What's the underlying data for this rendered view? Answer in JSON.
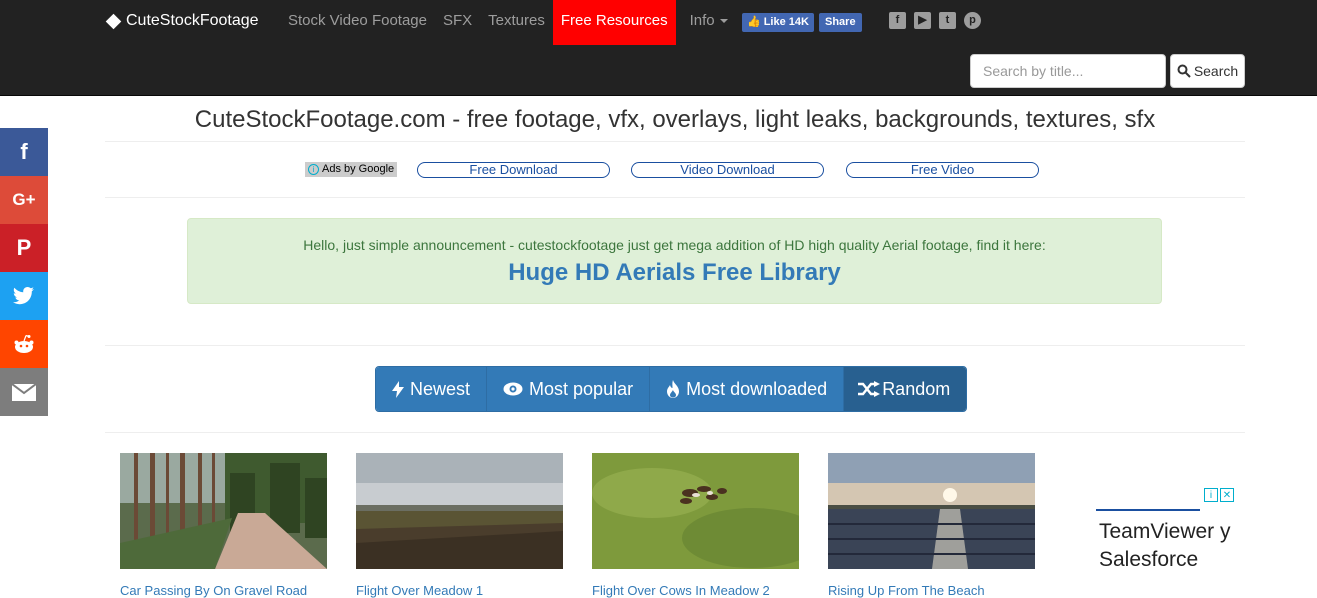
{
  "navbar": {
    "brand": "CuteStockFootage",
    "links": [
      {
        "label": "Stock Video Footage"
      },
      {
        "label": "SFX"
      },
      {
        "label": "Textures"
      },
      {
        "label": "Free Resources"
      },
      {
        "label": "Info"
      }
    ],
    "fb_like": "Like 14K",
    "fb_share": "Share",
    "social_icons": [
      "facebook-icon",
      "youtube-icon",
      "twitter-icon",
      "pinterest-icon"
    ],
    "search": {
      "placeholder": "Search by title...",
      "button": "Search"
    }
  },
  "share_bar": [
    {
      "icon": "facebook-icon",
      "glyph": "f",
      "color": "#3b5998"
    },
    {
      "icon": "google-plus-icon",
      "glyph": "G+",
      "color": "#dd4b39"
    },
    {
      "icon": "pinterest-icon",
      "glyph": "P",
      "color": "#cb2027"
    },
    {
      "icon": "twitter-icon",
      "glyph": "t",
      "color": "#1da1f2"
    },
    {
      "icon": "reddit-icon",
      "glyph": "r",
      "color": "#ff4500"
    },
    {
      "icon": "email-icon",
      "glyph": "✉",
      "color": "#7d7d7d"
    }
  ],
  "headline": "CuteStockFootage.com - free footage, vfx, overlays, light leaks, backgrounds, textures, sfx",
  "ads": {
    "label": "Ads by Google",
    "links": [
      "Free Download",
      "Video Download",
      "Free Video"
    ]
  },
  "announcement": {
    "text": "Hello, just simple announcement - cutestockfootage just get mega addition of HD high quality Aerial footage, find it here:",
    "link": "Huge HD Aerials Free Library"
  },
  "sort_buttons": [
    {
      "label": "Newest",
      "icon": "bolt-icon"
    },
    {
      "label": "Most popular",
      "icon": "eye-icon"
    },
    {
      "label": "Most downloaded",
      "icon": "fire-icon"
    },
    {
      "label": "Random",
      "icon": "shuffle-icon"
    }
  ],
  "videos": [
    {
      "title": "Car Passing By On Gravel Road",
      "thumbnail": "forest-road"
    },
    {
      "title": "Flight Over Meadow 1",
      "thumbnail": "aerial-meadow"
    },
    {
      "title": "Flight Over Cows In Meadow 2",
      "thumbnail": "cows-meadow"
    },
    {
      "title": "Rising Up From The Beach",
      "thumbnail": "beach-sunset"
    }
  ],
  "side_ad": {
    "text": "TeamViewer y Salesforce"
  },
  "colors": {
    "navbar_bg": "#222222",
    "active_nav": "#ff0000",
    "primary": "#337ab7",
    "alert_bg": "#dff0d8"
  }
}
